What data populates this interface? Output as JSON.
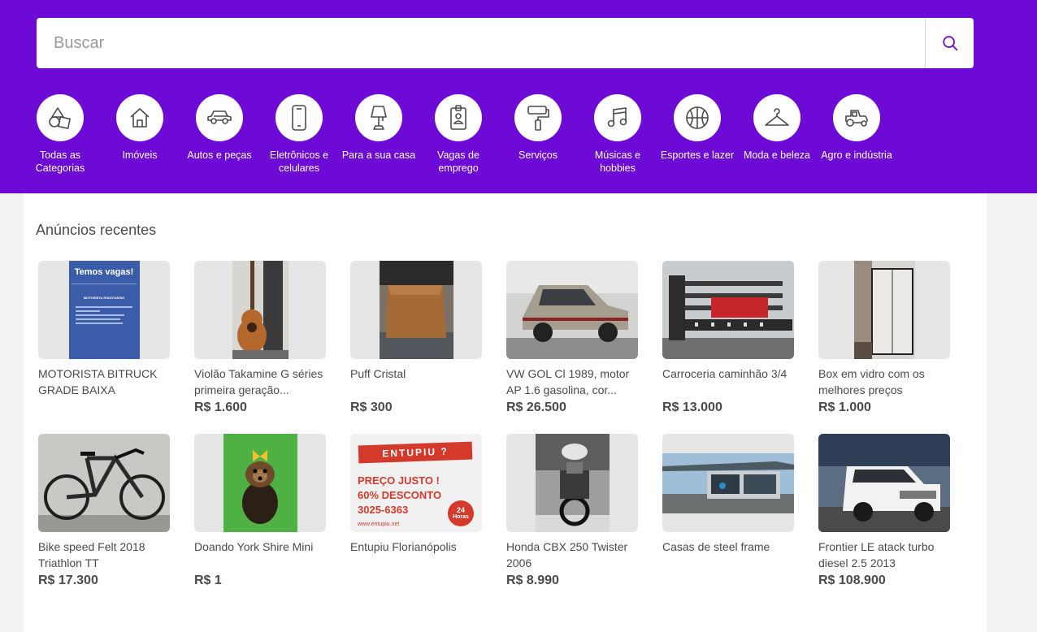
{
  "search": {
    "placeholder": "Buscar"
  },
  "categories": [
    {
      "label": "Todas as Categorias",
      "icon": "shapes-icon"
    },
    {
      "label": "Imóveis",
      "icon": "house-icon"
    },
    {
      "label": "Autos e peças",
      "icon": "car-icon"
    },
    {
      "label": "Eletrônicos e celulares",
      "icon": "phone-icon"
    },
    {
      "label": "Para a sua casa",
      "icon": "lamp-icon"
    },
    {
      "label": "Vagas de emprego",
      "icon": "badge-icon"
    },
    {
      "label": "Serviços",
      "icon": "paint-roller-icon"
    },
    {
      "label": "Músicas e hobbies",
      "icon": "music-note-icon"
    },
    {
      "label": "Esportes e lazer",
      "icon": "basketball-icon"
    },
    {
      "label": "Moda e beleza",
      "icon": "hanger-icon"
    },
    {
      "label": "Agro e indústria",
      "icon": "tractor-icon"
    }
  ],
  "recent": {
    "heading": "Anúncios recentes",
    "ads": [
      {
        "title": "MOTORISTA BITRUCK GRADE BAIXA",
        "price": ""
      },
      {
        "title": "Violão Takamine G séries primeira geração...",
        "price": "R$ 1.600"
      },
      {
        "title": "Puff Cristal",
        "price": "R$ 300"
      },
      {
        "title": "VW GOL Cl 1989, motor AP 1.6 gasolina, cor...",
        "price": "R$ 26.500"
      },
      {
        "title": "Carroceria caminhão 3/4",
        "price": "R$ 13.000"
      },
      {
        "title": "Box em vidro com os melhores preços",
        "price": "R$ 1.000"
      },
      {
        "title": "Bike speed Felt 2018 Triathlon TT",
        "price": "R$ 17.300"
      },
      {
        "title": "Doando York Shire Mini",
        "price": "R$ 1"
      },
      {
        "title": "Entupiu Florianópolis",
        "price": ""
      },
      {
        "title": "Honda CBX 250 Twister 2006",
        "price": "R$ 8.990"
      },
      {
        "title": "Casas de steel frame",
        "price": ""
      },
      {
        "title": "Frontier LE atack turbo diesel 2.5 2013",
        "price": "R$ 108.900"
      }
    ]
  },
  "thumb_text": {
    "vagas_headline": "Temos vagas!",
    "vagas_sub": "MOTORISTA RODOVIÁRIO",
    "entupiu_brand": "ENTUPIU ?",
    "entupiu_line1": "PREÇO JUSTO !",
    "entupiu_line2": "60% DESCONTO",
    "entupiu_phone": "3025-6363",
    "entupiu_url": "www.entupiu.net",
    "entupiu_badge_num": "24",
    "entupiu_badge_unit": "Horas"
  },
  "colors": {
    "brand": "#6e0ad6",
    "search_icon": "#6e0ad6",
    "text": "#4a4a4a"
  }
}
